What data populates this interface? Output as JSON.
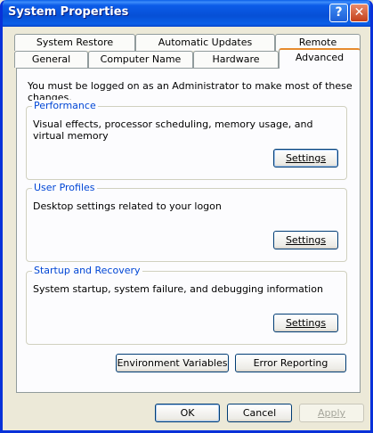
{
  "window": {
    "title": "System Properties"
  },
  "titlebar": {
    "help_glyph": "?",
    "close_glyph": "✕"
  },
  "tabs_back": [
    "System Restore",
    "Automatic Updates",
    "Remote"
  ],
  "tabs_front": [
    "General",
    "Computer Name",
    "Hardware",
    "Advanced"
  ],
  "active_tab": "Advanced",
  "panel": {
    "admin_note": "You must be logged on as an Administrator to make most of these changes.",
    "performance": {
      "title": "Performance",
      "desc": "Visual effects, processor scheduling, memory usage, and virtual memory",
      "button": "Settings"
    },
    "user_profiles": {
      "title": "User Profiles",
      "desc": "Desktop settings related to your logon",
      "button": "Settings"
    },
    "startup": {
      "title": "Startup and Recovery",
      "desc": "System startup, system failure, and debugging information",
      "button": "Settings"
    },
    "env_button": "Environment Variables",
    "error_button": "Error Reporting"
  },
  "footer": {
    "ok": "OK",
    "cancel": "Cancel",
    "apply": "Apply"
  },
  "colors": {
    "titlebar": "#0a5fe8",
    "group_title": "#0046d5",
    "tab_highlight": "#e68b2c"
  }
}
